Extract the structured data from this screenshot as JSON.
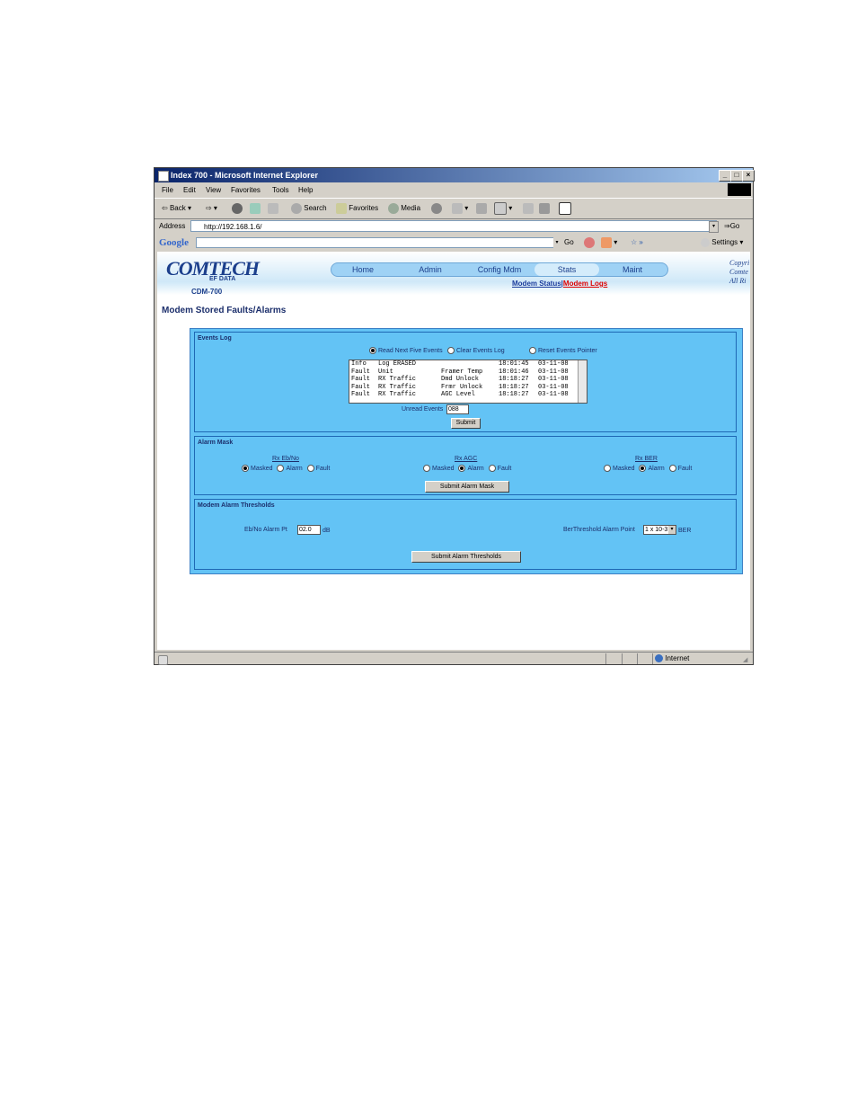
{
  "window": {
    "title": "Index 700 - Microsoft Internet Explorer"
  },
  "menu": [
    "File",
    "Edit",
    "View",
    "Favorites",
    "Tools",
    "Help"
  ],
  "toolbar": {
    "back": "Back",
    "search": "Search",
    "favorites": "Favorites",
    "media": "Media"
  },
  "address": {
    "label": "Address",
    "url": "http://192.168.1.6/",
    "go": "Go"
  },
  "google": {
    "brand": "Google",
    "go": "Go",
    "settings": "Settings"
  },
  "banner": {
    "logo": "OMTECH",
    "logo_sub": "EF DATA",
    "model": "CDM-700",
    "tabs": [
      {
        "label": "Home"
      },
      {
        "label": "Admin"
      },
      {
        "label": "Config Mdm"
      },
      {
        "label": "Stats"
      },
      {
        "label": "Maint"
      }
    ],
    "sublink_status": "Modem Status",
    "sublink_sep": "|",
    "sublink_logs": "Modem Logs",
    "copyright_lines": [
      "Copyri",
      "Comte",
      "All Ri"
    ]
  },
  "page": {
    "title": "Modem Stored Faults/Alarms"
  },
  "events_log": {
    "title": "Events Log",
    "options": [
      "Read Next Five Events",
      "Clear Events Log",
      "Reset Events Pointer"
    ],
    "rows": [
      {
        "type": "Info",
        "src": "Log ERASED",
        "desc": "",
        "time": "18:01:45",
        "date": "03-11-08"
      },
      {
        "type": "Fault",
        "src": "Unit",
        "desc": "Framer Temp",
        "time": "18:01:46",
        "date": "03-11-08"
      },
      {
        "type": "Fault",
        "src": "RX Traffic",
        "desc": "Dmd Unlock",
        "time": "18:18:27",
        "date": "03-11-08"
      },
      {
        "type": "Fault",
        "src": "RX Traffic",
        "desc": "Frmr Unlock",
        "time": "18:18:27",
        "date": "03-11-08"
      },
      {
        "type": "Fault",
        "src": "RX Traffic",
        "desc": "AGC Level",
        "time": "18:18:27",
        "date": "03-11-08"
      }
    ],
    "unread_label": "Unread Events",
    "unread_value": "088",
    "submit": "Submit"
  },
  "alarm_mask": {
    "title": "Alarm Mask",
    "groups": [
      {
        "label": "Rx Eb/No",
        "options": [
          "Masked",
          "Alarm",
          "Fault"
        ],
        "selected": "Masked"
      },
      {
        "label": "Rx AGC",
        "options": [
          "Masked",
          "Alarm",
          "Fault"
        ],
        "selected": "Alarm"
      },
      {
        "label": "Rx BER",
        "options": [
          "Masked",
          "Alarm",
          "Fault"
        ],
        "selected": "Alarm"
      }
    ],
    "submit": "Submit Alarm Mask"
  },
  "thresholds": {
    "title": "Modem Alarm Thresholds",
    "ebno_label": "Eb/No Alarm Pt",
    "ebno_value": "02.0",
    "ebno_unit": "dB",
    "ber_label": "BerThreshold Alarm Point",
    "ber_value": "1 x 10-3",
    "ber_unit": "BER",
    "submit": "Submit Alarm Thresholds"
  },
  "status": {
    "zone": "Internet"
  }
}
